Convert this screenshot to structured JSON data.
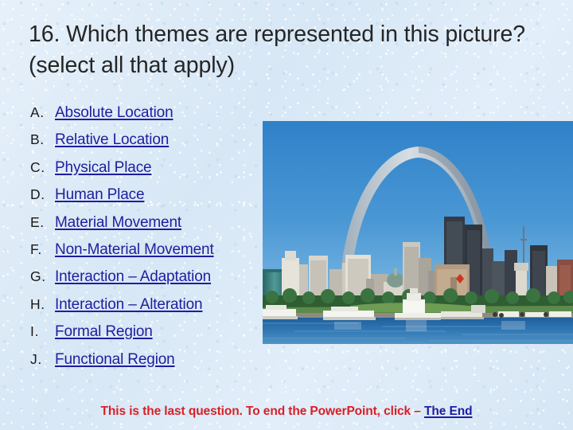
{
  "slide": {
    "background_color": "#dce9f6",
    "title": "16.  Which themes are represented in this picture? (select all that apply)"
  },
  "options": [
    {
      "letter": "A.",
      "label": "Absolute Location"
    },
    {
      "letter": "B.",
      "label": "Relative Location"
    },
    {
      "letter": "C.",
      "label": "Physical Place"
    },
    {
      "letter": "D.",
      "label": "Human Place"
    },
    {
      "letter": "E.",
      "label": "Material Movement"
    },
    {
      "letter": "F.",
      "label": "Non-Material Movement"
    },
    {
      "letter": "G.",
      "label": "Interaction – Adaptation"
    },
    {
      "letter": "H.",
      "label": "Interaction – Alteration"
    },
    {
      "letter": "I.",
      "label": "Formal Region"
    },
    {
      "letter": "J.",
      "label": "Functional Region"
    }
  ],
  "photo": {
    "alt": "St. Louis Gateway Arch with downtown skyline and Mississippi River riverboats",
    "sky_color": "#3f8fd0",
    "arch_color": "#c3cdd6",
    "water_color": "#2f6ea8"
  },
  "footer": {
    "text": "This is the last question.  To end the PowerPoint, click – ",
    "link_label": "The End",
    "text_color": "#d81f26",
    "link_color": "#1e1ea0"
  }
}
